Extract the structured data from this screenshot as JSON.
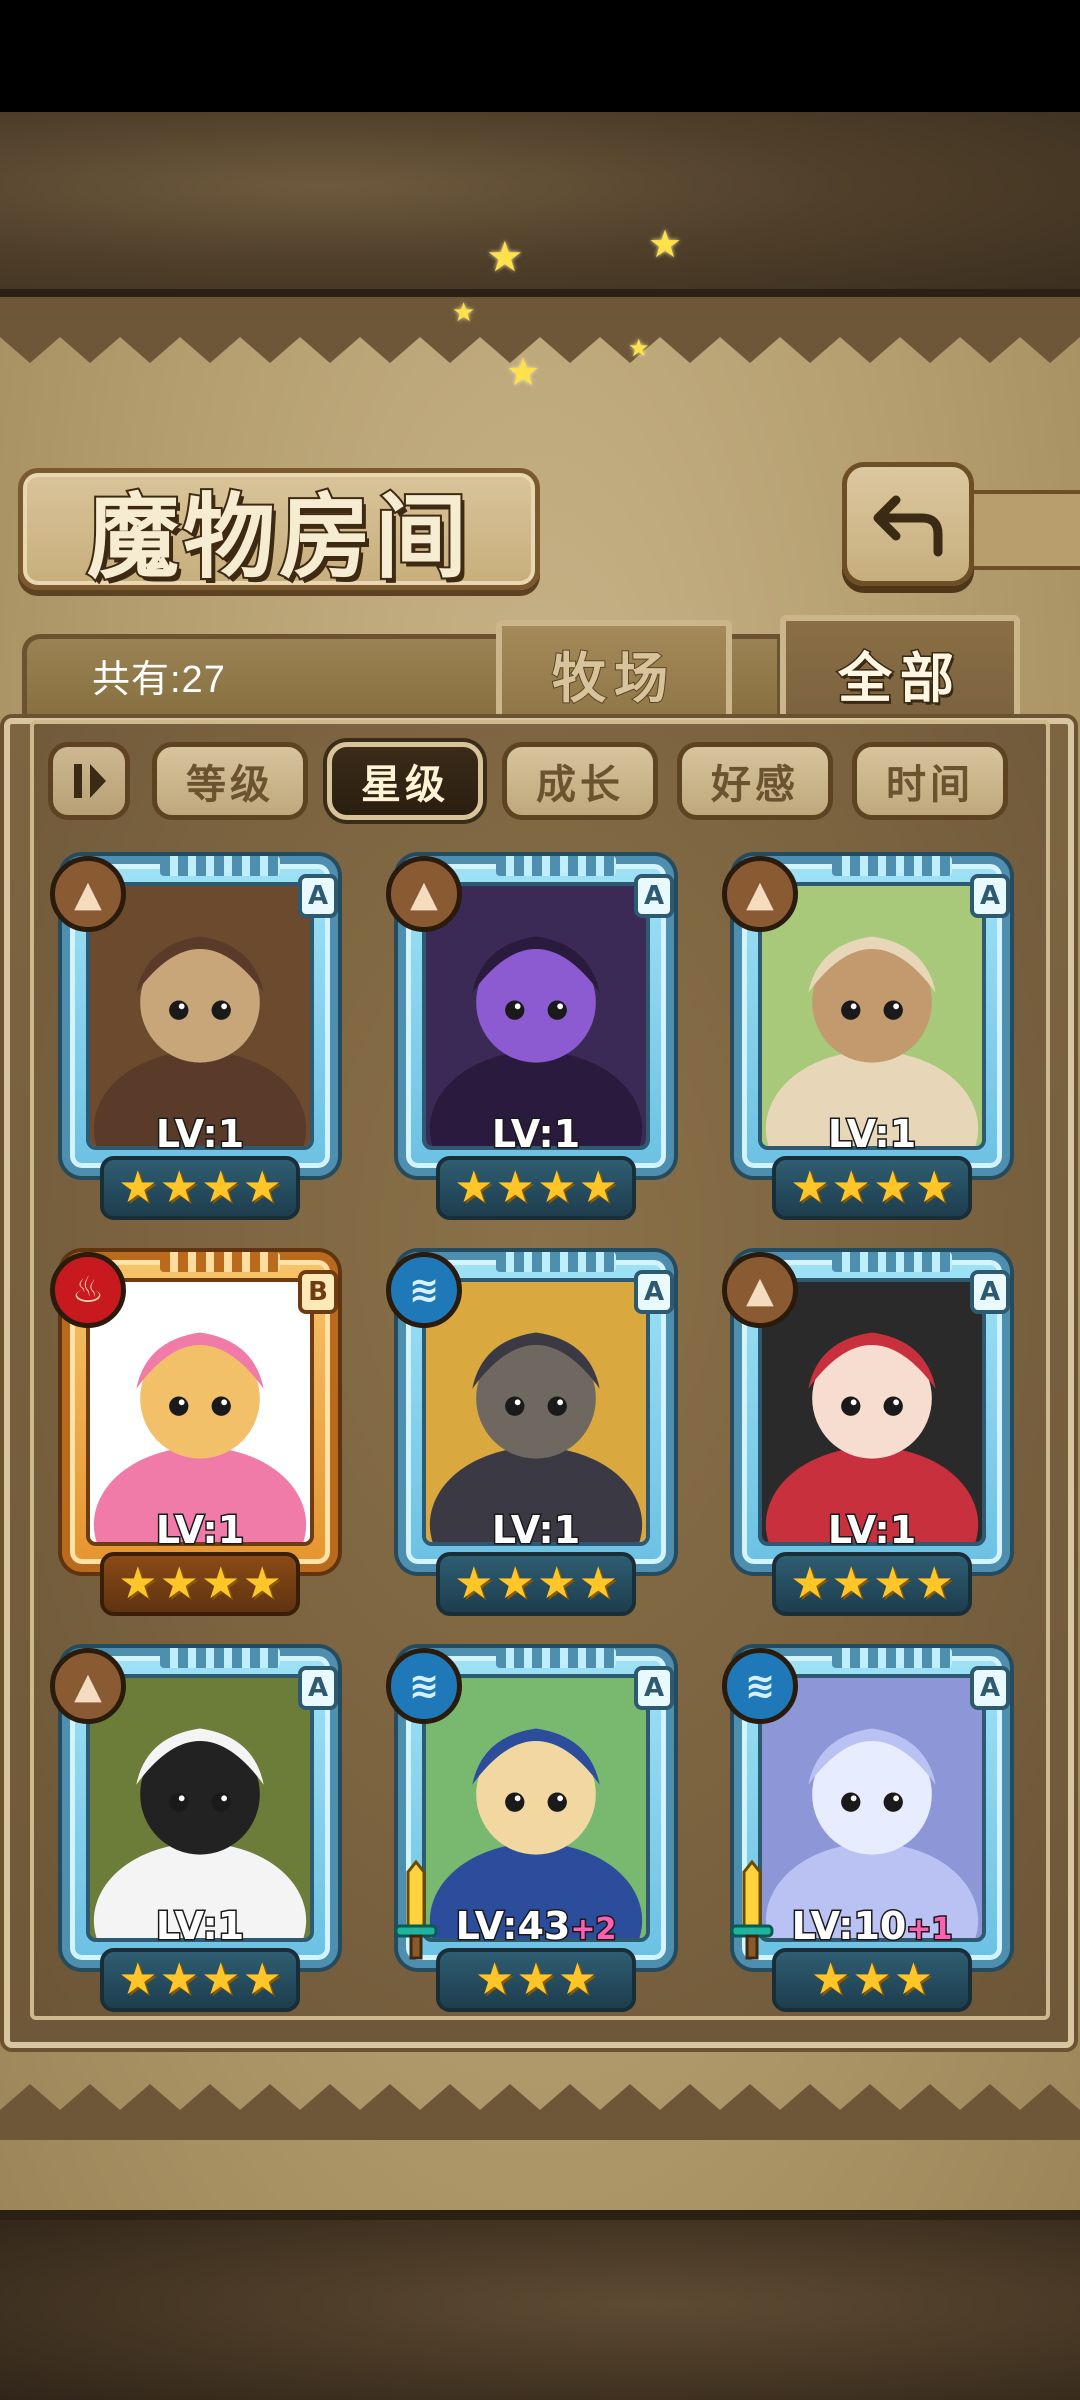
{
  "title": "魔物房间",
  "total_count_label": "共有:27",
  "tabs": [
    {
      "label": "牧场",
      "active": false
    },
    {
      "label": "全部",
      "active": true
    }
  ],
  "sort_buttons": [
    {
      "label": "等级",
      "active": false
    },
    {
      "label": "星级",
      "active": true
    },
    {
      "label": "成长",
      "active": false
    },
    {
      "label": "好感",
      "active": false
    },
    {
      "label": "时间",
      "active": false
    }
  ],
  "monsters": [
    {
      "level_text": "LV:1",
      "level_bonus": "",
      "rank": "A",
      "element": "earth",
      "stars": 4,
      "weapon": false,
      "palette": [
        "#5a3b2a",
        "#c9a57a",
        "#6b4a2e"
      ]
    },
    {
      "level_text": "LV:1",
      "level_bonus": "",
      "rank": "A",
      "element": "earth",
      "stars": 4,
      "weapon": false,
      "palette": [
        "#2a1a3e",
        "#8d5bd1",
        "#3b2a55"
      ]
    },
    {
      "level_text": "LV:1",
      "level_bonus": "",
      "rank": "A",
      "element": "earth",
      "stars": 4,
      "weapon": false,
      "palette": [
        "#e8d6b8",
        "#c29a6e",
        "#a8c97a"
      ]
    },
    {
      "level_text": "LV:1",
      "level_bonus": "",
      "rank": "B",
      "element": "fire",
      "stars": 4,
      "weapon": false,
      "palette": [
        "#f07aa8",
        "#f3c06a",
        "#ffffff"
      ]
    },
    {
      "level_text": "LV:1",
      "level_bonus": "",
      "rank": "A",
      "element": "water",
      "stars": 4,
      "weapon": false,
      "palette": [
        "#3b3a44",
        "#6f6860",
        "#d9a83f"
      ]
    },
    {
      "level_text": "LV:1",
      "level_bonus": "",
      "rank": "A",
      "element": "earth",
      "stars": 4,
      "weapon": false,
      "palette": [
        "#c8303e",
        "#f7dcd0",
        "#2a2a2a"
      ]
    },
    {
      "level_text": "LV:1",
      "level_bonus": "",
      "rank": "A",
      "element": "earth",
      "stars": 4,
      "weapon": false,
      "palette": [
        "#f4f4f4",
        "#222222",
        "#6c7d3a"
      ]
    },
    {
      "level_text": "LV:43",
      "level_bonus": "+2",
      "rank": "A",
      "element": "water",
      "stars": 3,
      "weapon": true,
      "palette": [
        "#2b4d9c",
        "#f3d7a0",
        "#78b86f"
      ]
    },
    {
      "level_text": "LV:10",
      "level_bonus": "+1",
      "rank": "A",
      "element": "water",
      "stars": 3,
      "weapon": true,
      "palette": [
        "#b9c2f2",
        "#e8ecff",
        "#8d97d8"
      ]
    }
  ],
  "icons": {
    "back": "back-arrow-icon",
    "sort_toggle": "sort-order-icon",
    "earth": "earth-element-icon",
    "fire": "fire-element-icon",
    "water": "water-element-icon",
    "weapon": "sword-icon"
  }
}
